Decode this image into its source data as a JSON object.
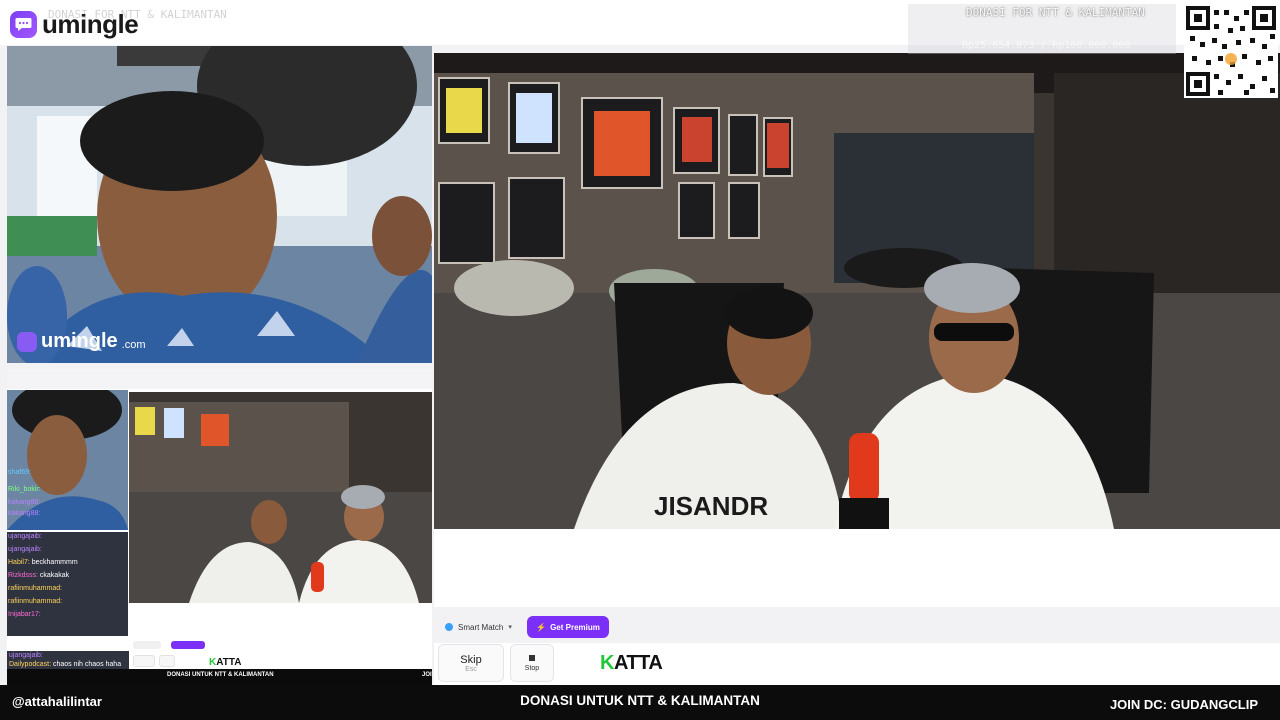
{
  "app": {
    "brand_name": "umingle",
    "ghost_title": "DONASI FOR NTT & KALIMANTAN"
  },
  "donation": {
    "title": "DONASI FOR NTT & KALIMANTAN",
    "amount": "Rp25.654.873 / Rp100.000.000"
  },
  "left_video": {
    "watermark_name": "umingle",
    "watermark_domain": ".com"
  },
  "controls": {
    "smart_match_label": "Smart Match",
    "premium_label": "Get Premium",
    "skip_label": "Skip",
    "skip_hint": "Esc",
    "stop_label": "Stop",
    "partner_logo_k": "K",
    "partner_logo_rest": "ATTA"
  },
  "mini_preview": {
    "chat_lines": [
      {
        "user": "shaf69:",
        "text": "",
        "cls": "u1"
      },
      {
        "user": "Riki_bokir:",
        "text": "",
        "cls": "u2"
      },
      {
        "user": "kakang88:",
        "text": "",
        "cls": "u5"
      },
      {
        "user": "kakang88:",
        "text": "",
        "cls": "u5"
      }
    ],
    "chat_lines_bottom": [
      {
        "user": "ujangajaib:",
        "text": "",
        "cls": "u5"
      },
      {
        "user": "ujangajaib:",
        "text": "",
        "cls": "u5"
      },
      {
        "user": "Habil7:",
        "text": "beckhammmm",
        "cls": "u4"
      },
      {
        "user": "Rizkdsss:",
        "text": "ckakakak",
        "cls": "u3"
      },
      {
        "user": "rafiinmuhammad:",
        "text": "",
        "cls": "u4"
      },
      {
        "user": "rafiinmuhammad:",
        "text": "",
        "cls": "u4"
      },
      {
        "user": "Inijabar17:",
        "text": "",
        "cls": "u3"
      }
    ],
    "chat_last_user": "ujangajaib:",
    "chat_last_2_user": "Dailypodcast:",
    "chat_last_2_text": "chaos nih chaos haha",
    "footer_text": "DONASI UNTUK NTT & KALIMANTAN",
    "footer_right": "JOI"
  },
  "bottom_bar": {
    "handle": "@attahalilintar",
    "center_text": "DONASI UNTUK NTT & KALIMANTAN",
    "right_text": "JOIN DC: GUDANGCLIP"
  },
  "colors": {
    "accent": "#7b2ff7",
    "brand_purple": "#8f4bff",
    "partner_green": "#22c83a",
    "banner_bg": "#0c0c0c"
  }
}
